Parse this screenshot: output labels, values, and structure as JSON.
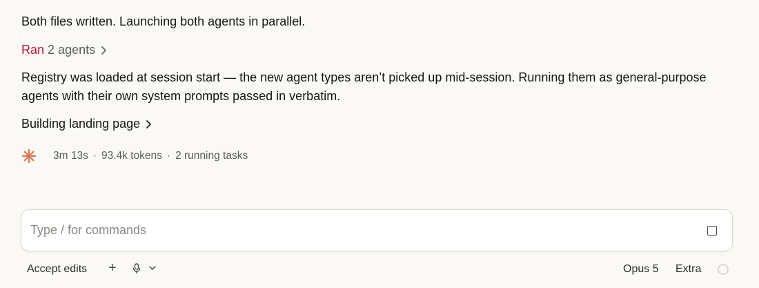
{
  "messages": {
    "line1": "Both files written. Launching both agents in parallel.",
    "ran": {
      "verb": "Ran",
      "count": "2 agents"
    },
    "paragraph": "Registry was loaded at session start — the new agent types aren’t picked up mid-session. Running them as general-purpose agents with their own system prompts passed in verbatim.",
    "building": "Building landing page"
  },
  "status": {
    "icon": "spinner-sparkle-icon",
    "icon_color": "#d97757",
    "elapsed": "3m 13s",
    "separator": "·",
    "tokens": "93.4k tokens",
    "tasks": "2 running tasks"
  },
  "composer": {
    "placeholder": "Type / for commands",
    "value": ""
  },
  "toolbar": {
    "mode": "Accept edits",
    "plus": "+",
    "model": "Opus 5",
    "effort": "Extra"
  },
  "colors": {
    "background": "#faf9f5",
    "accent_red": "#b5173a",
    "spinner": "#d97757"
  }
}
